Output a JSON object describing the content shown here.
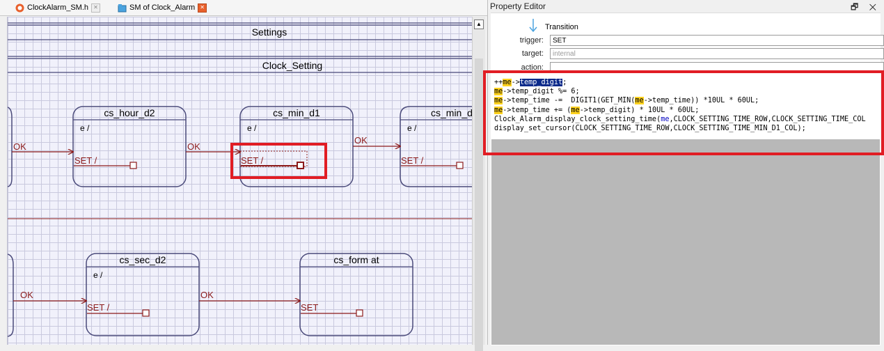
{
  "tabs": [
    {
      "label": "ClockAlarm_SM.h",
      "close": "✕",
      "active": false
    },
    {
      "label": "SM of Clock_Alarm",
      "close": "✕",
      "active": true
    }
  ],
  "diagram": {
    "superstates": [
      "Settings",
      "Clock_Setting"
    ],
    "states": [
      {
        "name": "cs_hour_d2",
        "entry": "e /",
        "set": "SET /"
      },
      {
        "name": "cs_min_d1",
        "entry": "e /",
        "set": "SET /"
      },
      {
        "name": "cs_min_d",
        "entry": "e /",
        "set": "SET /"
      },
      {
        "name": "cs_sec_d2",
        "entry": "e /",
        "set": "SET /"
      },
      {
        "name": "cs_form at",
        "entry": "",
        "set": "SET"
      }
    ],
    "ok_label": "OK"
  },
  "property_editor": {
    "title": "Property Editor",
    "controls": "🗗 ✕",
    "type_label": "Transition",
    "trigger_label": "trigger:",
    "trigger_value": "SET",
    "target_label": "target:",
    "target_value": "internal",
    "action_label": "action:",
    "code": [
      "++me->temp_digit;",
      "me->temp_digit %= 6;",
      "me->temp_time -=  DIGIT1(GET_MIN(me->temp_time)) *10UL * 60UL;",
      "me->temp_time += (me->temp_digit) * 10UL * 60UL;",
      "Clock_Alarm_display_clock_setting_time(me,CLOCK_SETTING_TIME_ROW,CLOCK_SETTING_TIME_COL",
      "display_set_cursor(CLOCK_SETTING_TIME_ROW,CLOCK_SETTING_TIME_MIN_D1_COL);"
    ]
  },
  "colors": {
    "accent": "#e11d24",
    "state_border": "#4a4a7a",
    "transition": "#8b1a1a",
    "me_highlight": "#ffd21e"
  }
}
